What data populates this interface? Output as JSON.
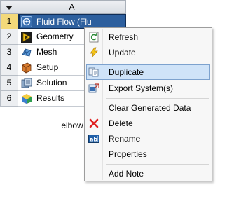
{
  "system": {
    "column_header": "A",
    "caption": "elbow",
    "rows": [
      {
        "num": "1",
        "label": "Fluid Flow (Flu",
        "icon": "fluid-flow-icon",
        "selected": true
      },
      {
        "num": "2",
        "label": "Geometry",
        "icon": "geometry-icon"
      },
      {
        "num": "3",
        "label": "Mesh",
        "icon": "mesh-icon"
      },
      {
        "num": "4",
        "label": "Setup",
        "icon": "setup-icon"
      },
      {
        "num": "5",
        "label": "Solution",
        "icon": "solution-icon"
      },
      {
        "num": "6",
        "label": "Results",
        "icon": "results-icon"
      }
    ]
  },
  "context_menu": {
    "items": [
      {
        "label": "Refresh",
        "icon": "refresh-icon"
      },
      {
        "label": "Update",
        "icon": "update-lightning-icon"
      },
      {
        "label": "Duplicate",
        "icon": "duplicate-icon",
        "highlighted": true
      },
      {
        "label": "Export System(s)",
        "icon": "export-system-icon"
      },
      {
        "label": "Clear Generated Data"
      },
      {
        "label": "Delete",
        "icon": "delete-x-icon"
      },
      {
        "label": "Rename",
        "icon": "rename-icon"
      },
      {
        "label": "Properties"
      },
      {
        "label": "Add Note"
      }
    ]
  },
  "colors": {
    "selected_cell": "#2d5f9e",
    "selected_rownum": "#f3d97a",
    "menu_highlight": "#cfe3f8",
    "delete_icon": "#e02020"
  }
}
